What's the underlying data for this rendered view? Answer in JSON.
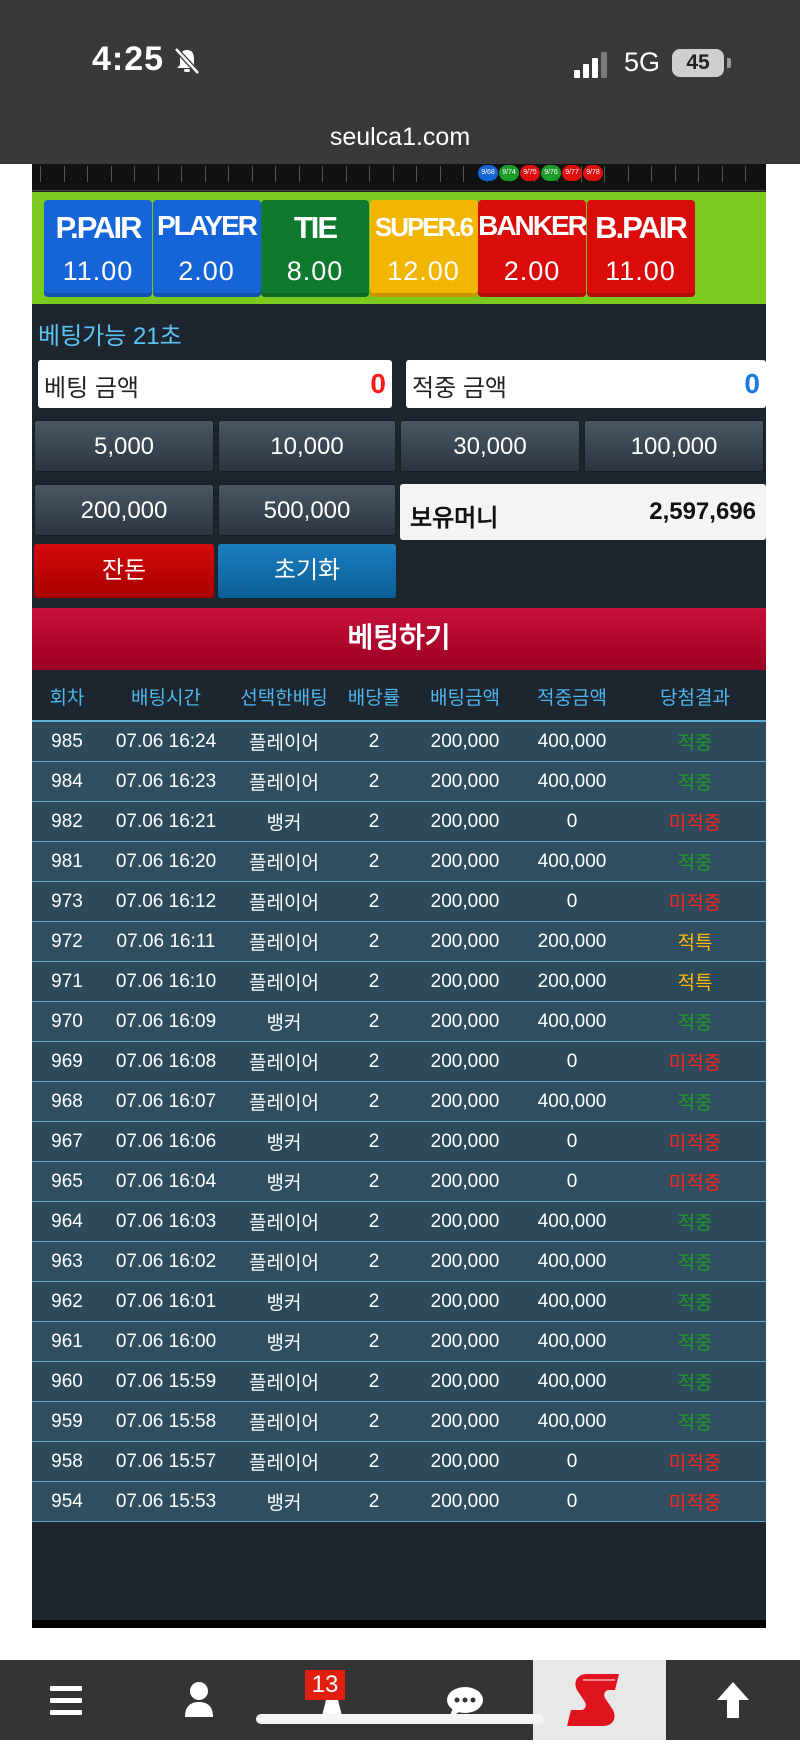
{
  "status_bar": {
    "time": "4:25",
    "network": "5G",
    "battery": "45"
  },
  "browser": {
    "url": "seulca1.com"
  },
  "roadmap": {
    "dots": [
      {
        "label": "9/68",
        "color": "#1565d8"
      },
      {
        "label": "9/74",
        "color": "#1c9c2a"
      },
      {
        "label": "9/75",
        "color": "#e01010"
      },
      {
        "label": "9/76",
        "color": "#1c9c2a"
      },
      {
        "label": "9/77",
        "color": "#e01010"
      },
      {
        "label": "9/78",
        "color": "#e01010"
      }
    ]
  },
  "bet_options": [
    {
      "name": "P.PAIR",
      "odds": "11.00",
      "color": "#1565d8",
      "text_color": "#ffffff"
    },
    {
      "name": "PLAYER",
      "odds": "2.00",
      "color": "#1565d8",
      "text_color": "#ffffff"
    },
    {
      "name": "TIE",
      "odds": "8.00",
      "color": "#0f7a2e",
      "text_color": "#ffffff"
    },
    {
      "name": "SUPER.6",
      "odds": "12.00",
      "color": "#f2b600",
      "text_color": "#ffffff"
    },
    {
      "name": "BANKER",
      "odds": "2.00",
      "color": "#d90b0b",
      "text_color": "#ffffff"
    },
    {
      "name": "B.PAIR",
      "odds": "11.00",
      "color": "#d90b0b",
      "text_color": "#ffffff"
    }
  ],
  "countdown": "베팅가능 21초",
  "bet_amount": {
    "label": "베팅 금액",
    "value": "0",
    "color": "#ff1a1a"
  },
  "win_amount": {
    "label": "적중 금액",
    "value": "0",
    "color": "#1a78e6"
  },
  "chips": [
    "5,000",
    "10,000",
    "30,000",
    "100,000",
    "200,000",
    "500,000"
  ],
  "wallet": {
    "label": "보유머니",
    "value": "2,597,696"
  },
  "buttons": {
    "change": "잔돈",
    "reset": "초기화",
    "place_bet": "베팅하기"
  },
  "history": {
    "headers": [
      "회차",
      "배팅시간",
      "선택한배팅",
      "배당률",
      "배팅금액",
      "적중금액",
      "당첨결과"
    ],
    "rows": [
      [
        "985",
        "07.06 16:24",
        "플레이어",
        "2",
        "200,000",
        "400,000",
        "적중"
      ],
      [
        "984",
        "07.06 16:23",
        "플레이어",
        "2",
        "200,000",
        "400,000",
        "적중"
      ],
      [
        "982",
        "07.06 16:21",
        "뱅커",
        "2",
        "200,000",
        "0",
        "미적중"
      ],
      [
        "981",
        "07.06 16:20",
        "플레이어",
        "2",
        "200,000",
        "400,000",
        "적중"
      ],
      [
        "973",
        "07.06 16:12",
        "플레이어",
        "2",
        "200,000",
        "0",
        "미적중"
      ],
      [
        "972",
        "07.06 16:11",
        "플레이어",
        "2",
        "200,000",
        "200,000",
        "적특"
      ],
      [
        "971",
        "07.06 16:10",
        "플레이어",
        "2",
        "200,000",
        "200,000",
        "적특"
      ],
      [
        "970",
        "07.06 16:09",
        "뱅커",
        "2",
        "200,000",
        "400,000",
        "적중"
      ],
      [
        "969",
        "07.06 16:08",
        "플레이어",
        "2",
        "200,000",
        "0",
        "미적중"
      ],
      [
        "968",
        "07.06 16:07",
        "플레이어",
        "2",
        "200,000",
        "400,000",
        "적중"
      ],
      [
        "967",
        "07.06 16:06",
        "뱅커",
        "2",
        "200,000",
        "0",
        "미적중"
      ],
      [
        "965",
        "07.06 16:04",
        "뱅커",
        "2",
        "200,000",
        "0",
        "미적중"
      ],
      [
        "964",
        "07.06 16:03",
        "플레이어",
        "2",
        "200,000",
        "400,000",
        "적중"
      ],
      [
        "963",
        "07.06 16:02",
        "플레이어",
        "2",
        "200,000",
        "400,000",
        "적중"
      ],
      [
        "962",
        "07.06 16:01",
        "뱅커",
        "2",
        "200,000",
        "400,000",
        "적중"
      ],
      [
        "961",
        "07.06 16:00",
        "뱅커",
        "2",
        "200,000",
        "400,000",
        "적중"
      ],
      [
        "960",
        "07.06 15:59",
        "플레이어",
        "2",
        "200,000",
        "400,000",
        "적중"
      ],
      [
        "959",
        "07.06 15:58",
        "플레이어",
        "2",
        "200,000",
        "400,000",
        "적중"
      ],
      [
        "958",
        "07.06 15:57",
        "플레이어",
        "2",
        "200,000",
        "0",
        "미적중"
      ],
      [
        "954",
        "07.06 15:53",
        "뱅커",
        "2",
        "200,000",
        "0",
        "미적중"
      ]
    ]
  },
  "bottom_nav": {
    "items": [
      {
        "icon": "menu-icon"
      },
      {
        "icon": "user-icon"
      },
      {
        "icon": "notification-icon"
      },
      {
        "icon": "chat-icon"
      },
      {
        "icon": "brand-logo"
      },
      {
        "icon": "arrow-up-icon"
      }
    ],
    "badge": "13"
  }
}
